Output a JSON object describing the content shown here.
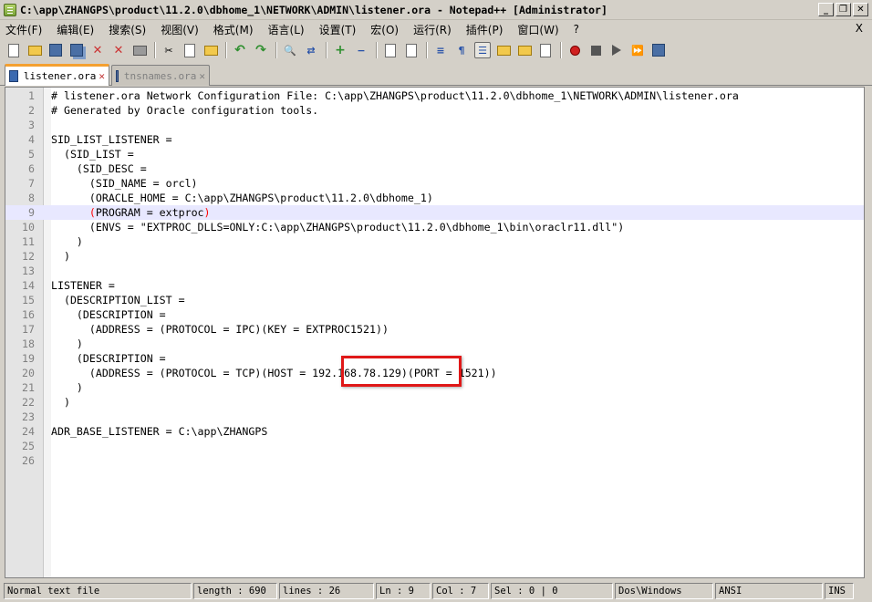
{
  "window": {
    "title": "C:\\app\\ZHANGPS\\product\\11.2.0\\dbhome_1\\NETWORK\\ADMIN\\listener.ora - Notepad++ [Administrator]",
    "minimize": "_",
    "restore": "❐",
    "close": "✕"
  },
  "menu": {
    "items": [
      "文件(F)",
      "编辑(E)",
      "搜索(S)",
      "视图(V)",
      "格式(M)",
      "语言(L)",
      "设置(T)",
      "宏(O)",
      "运行(R)",
      "插件(P)",
      "窗口(W)",
      "?"
    ],
    "close_doc": "X"
  },
  "tabs": [
    {
      "label": "listener.ora",
      "close": "✕"
    },
    {
      "label": "tnsnames.ora",
      "close": "✕"
    }
  ],
  "editor": {
    "current_line": 9,
    "lines": [
      "# listener.ora Network Configuration File: C:\\app\\ZHANGPS\\product\\11.2.0\\dbhome_1\\NETWORK\\ADMIN\\listener.ora",
      "# Generated by Oracle configuration tools.",
      "",
      "SID_LIST_LISTENER =",
      "  (SID_LIST =",
      "    (SID_DESC =",
      "      (SID_NAME = orcl)",
      "      (ORACLE_HOME = C:\\app\\ZHANGPS\\product\\11.2.0\\dbhome_1)",
      "      (PROGRAM = extproc)",
      "      (ENVS = \"EXTPROC_DLLS=ONLY:C:\\app\\ZHANGPS\\product\\11.2.0\\dbhome_1\\bin\\oraclr11.dll\")",
      "    )",
      "  )",
      "",
      "LISTENER =",
      "  (DESCRIPTION_LIST =",
      "    (DESCRIPTION =",
      "      (ADDRESS = (PROTOCOL = IPC)(KEY = EXTPROC1521))",
      "    )",
      "    (DESCRIPTION =",
      "      (ADDRESS = (PROTOCOL = TCP)(HOST = 192.168.78.129)(PORT = 1521))",
      "    )",
      "  )",
      "",
      "ADR_BASE_LISTENER = C:\\app\\ZHANGPS",
      "",
      ""
    ]
  },
  "status": {
    "file_type": "Normal text file",
    "length": "length : 690",
    "lines": "lines : 26",
    "ln": "Ln : 9",
    "col": "Col : 7",
    "sel": "Sel : 0 | 0",
    "eol": "Dos\\Windows",
    "encoding": "ANSI",
    "mode": "INS"
  },
  "colors": {
    "current_line_bg": "#e8e8ff",
    "highlight_box": "#e01818",
    "active_tab_accent": "#f4a030"
  }
}
